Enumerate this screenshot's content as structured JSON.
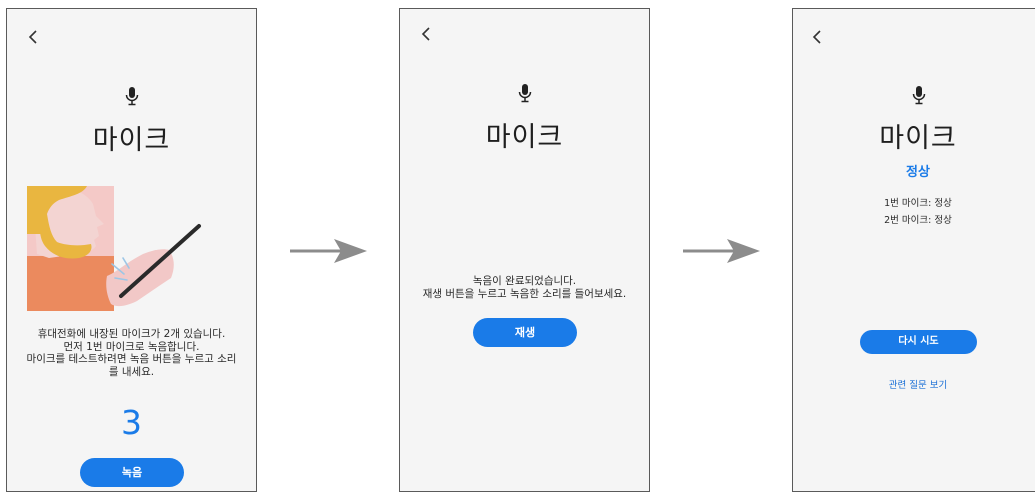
{
  "screen1": {
    "title": "마이크",
    "description_lines": [
      "휴대전화에 내장된 마이크가 2개 있습니다.",
      "먼저 1번 마이크로 녹음합니다.",
      "마이크를 테스트하려면 녹음 버튼을 누르고 소리",
      "를 내세요."
    ],
    "countdown": "3",
    "record_button": "녹음"
  },
  "screen2": {
    "title": "마이크",
    "message_lines": [
      "녹음이 완료되었습니다.",
      "재생 버튼을 누르고 녹음한 소리를 들어보세요."
    ],
    "play_button": "재생"
  },
  "screen3": {
    "title": "마이크",
    "status": "정상",
    "results": [
      "1번 마이크: 정상",
      "2번 마이크: 정상"
    ],
    "retry_button": "다시 시도",
    "related_link": "관련 질문 보기"
  },
  "colors": {
    "accent": "#1a7be8",
    "link": "#1a6fd6",
    "screen_bg": "#f5f5f5",
    "arrow": "#8c8c8c"
  },
  "icons": [
    "back-chevron-icon",
    "microphone-icon",
    "right-arrow-icon"
  ]
}
